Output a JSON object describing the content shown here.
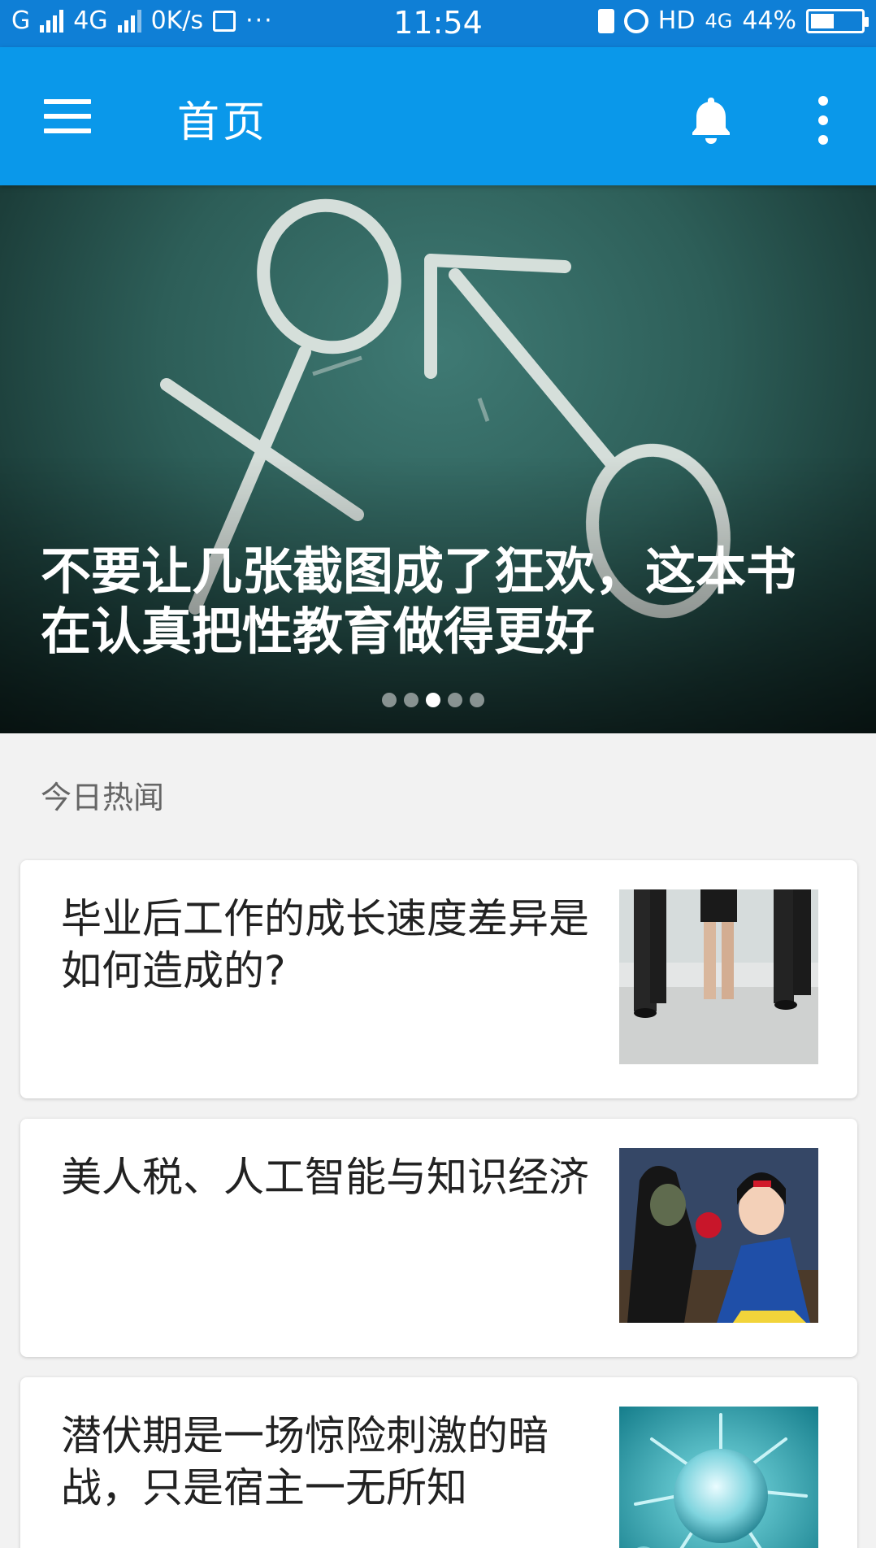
{
  "status_bar": {
    "network_1": "G",
    "network_2": "4G",
    "speed": "0K/s",
    "time": "11:54",
    "hd": "HD",
    "network_3": "4G",
    "battery": "44%"
  },
  "app_bar": {
    "title": "首页"
  },
  "banner": {
    "title": "不要让几张截图成了狂欢，这本书在认真把性教育做得更好",
    "active_index": 2,
    "slide_count": 5
  },
  "section": {
    "label": "今日热闻"
  },
  "articles": [
    {
      "title": "毕业后工作的成长速度差异是如何造成的?"
    },
    {
      "title": "美人税、人工智能与知识经济"
    },
    {
      "title": "潜伏期是一场惊险刺激的暗战，只是宿主一无所知"
    }
  ],
  "colors": {
    "status_bar": "#0f7fd6",
    "app_bar": "#0a98ea",
    "background": "#f2f2f2"
  }
}
